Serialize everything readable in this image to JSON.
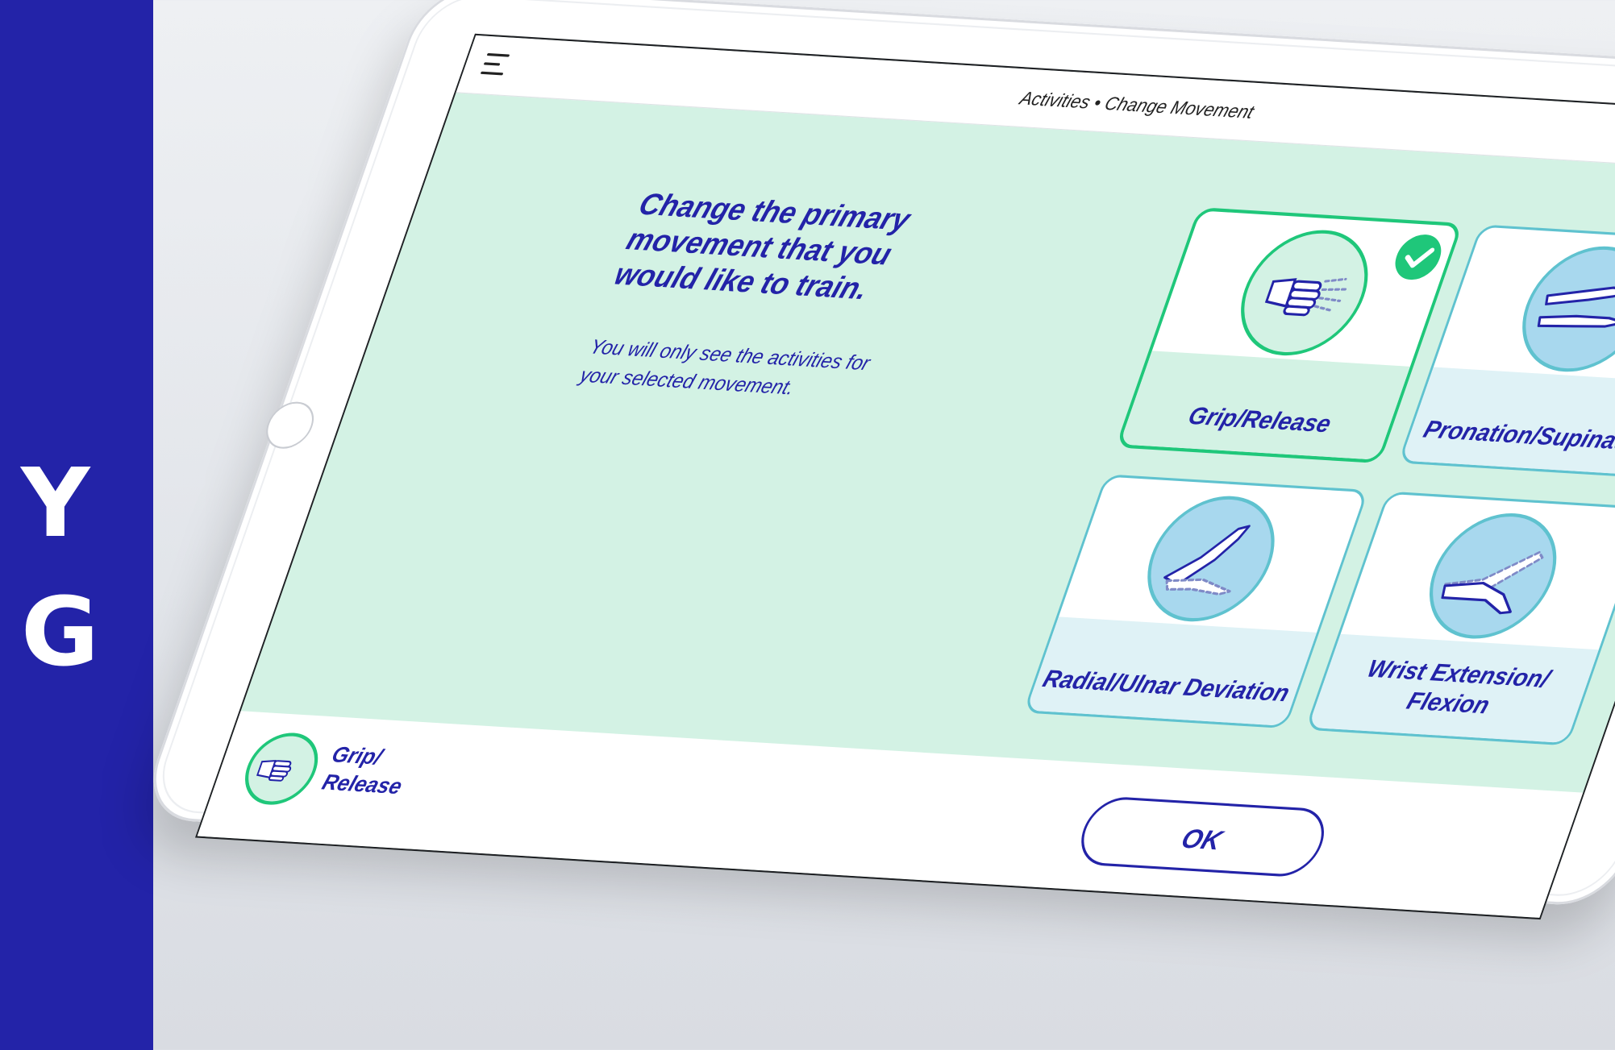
{
  "brand": {
    "letters": [
      "Y",
      "G"
    ],
    "color": "#2323a8"
  },
  "header": {
    "menu_icon": "hamburger-menu-icon",
    "title": "Activities • Change Movement"
  },
  "prompt": {
    "heading": "Change the primary movement that you would like to train.",
    "subtext": "You will only see the activities for your selected movement."
  },
  "movements": [
    {
      "label": "Grip/Release",
      "icon": "grip-release-hand-icon",
      "selected": true
    },
    {
      "label": "Pronation/Supination",
      "icon": "pronation-supination-hand-icon",
      "selected": false
    },
    {
      "label": "Radial/Ulnar Deviation",
      "icon": "radial-ulnar-deviation-hand-icon",
      "selected": false
    },
    {
      "label": "Wrist Extension/ Flexion",
      "icon": "wrist-extension-flexion-hand-icon",
      "selected": false
    }
  ],
  "footer": {
    "selected_label": "Grip/ Release",
    "selected_icon": "grip-release-hand-icon",
    "ok_label": "OK"
  },
  "colors": {
    "accent": "#2323a8",
    "selected": "#1fc77a",
    "screen_bg": "#d3f2e4",
    "card_border": "#5fc2cf"
  }
}
